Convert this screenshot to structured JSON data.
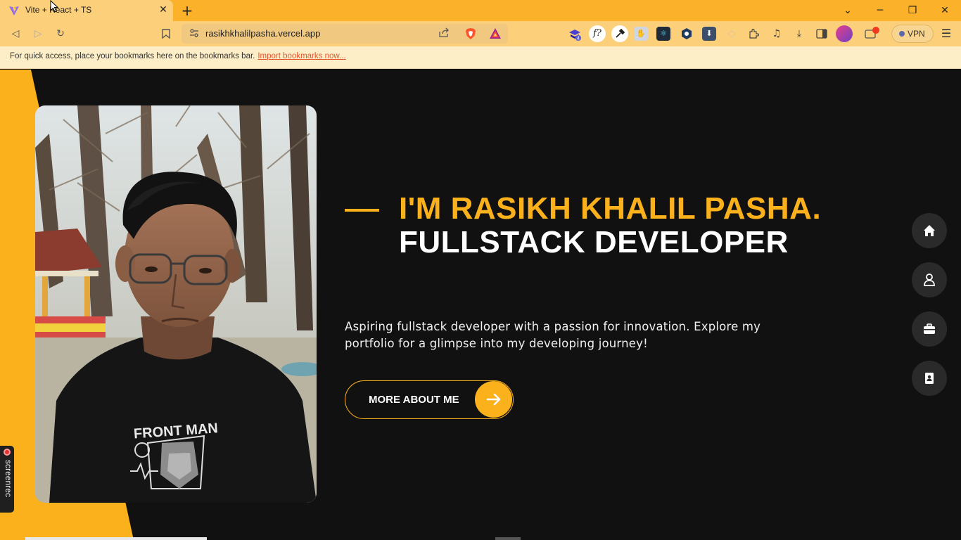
{
  "browser": {
    "tab_title": "Vite + React + TS",
    "new_tab_label": "+",
    "url": "rasikhkhalilpasha.vercel.app",
    "vpn_label": "VPN",
    "bookmarks_message": "For quick access, place your bookmarks here on the bookmarks bar.",
    "bookmarks_link": "Import bookmarks now...",
    "extension_badge": "4",
    "extension_font_label": "f?"
  },
  "hero": {
    "greeting": "I'M RASIKH KHALIL PASHA.",
    "role": "FULLSTACK DEVELOPER",
    "description": "Aspiring fullstack developer with a passion for innovation. Explore my portfolio for a glimpse into my developing journey!",
    "cta_label": "MORE ABOUT ME"
  },
  "side_nav": [
    {
      "icon": "home-icon"
    },
    {
      "icon": "user-icon"
    },
    {
      "icon": "briefcase-icon"
    },
    {
      "icon": "contact-icon"
    }
  ],
  "overlay": {
    "screenrec_label": "screenrec"
  },
  "colors": {
    "accent": "#fbb11c",
    "background": "#111111",
    "browser_frame": "#fbb12a"
  }
}
